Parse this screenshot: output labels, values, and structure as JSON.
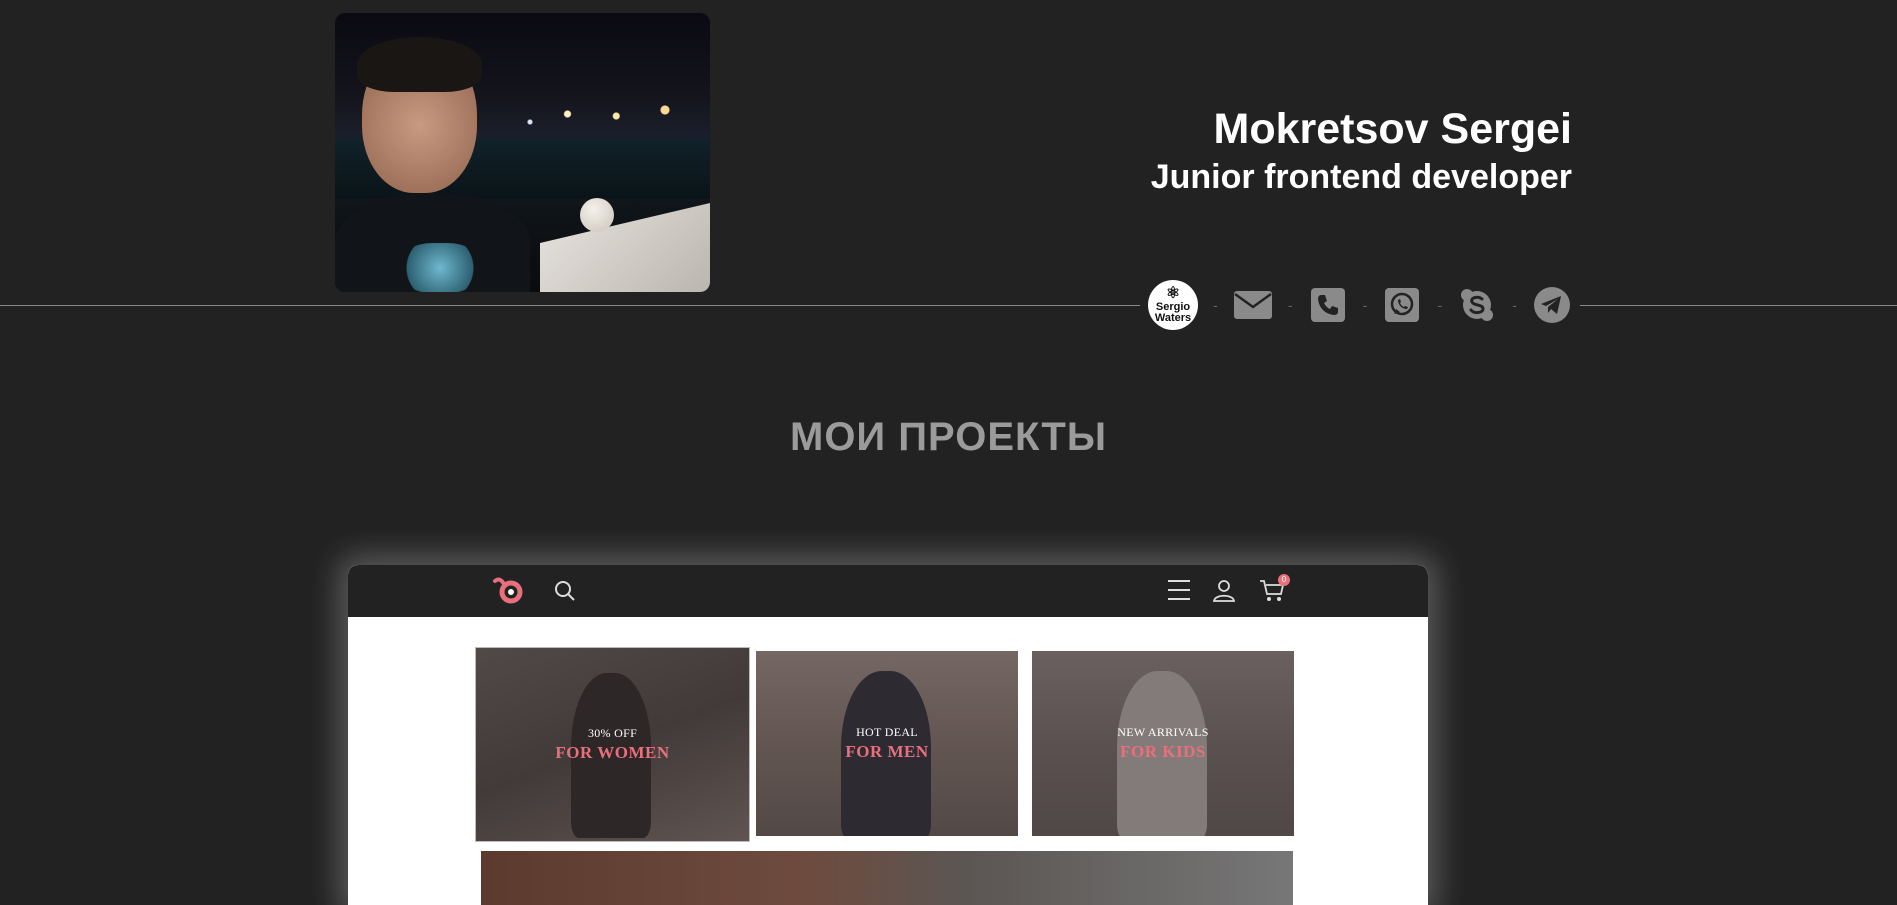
{
  "profile": {
    "name": "Mokretsov Sergei",
    "role": "Junior frontend developer",
    "photo_alt": "avatar"
  },
  "contacts": {
    "logo_line1": "Sergio",
    "logo_line2": "Waters",
    "items": [
      {
        "icon": "envelope-icon"
      },
      {
        "icon": "phone-icon"
      },
      {
        "icon": "whatsapp-icon"
      },
      {
        "icon": "skype-icon"
      },
      {
        "icon": "telegram-icon"
      }
    ],
    "separator": "-"
  },
  "projects": {
    "title": "МОИ ПРОЕКТЫ",
    "preview": {
      "cart_count": "0",
      "cards": [
        {
          "small": "30% OFF",
          "big": "FOR WOMEN"
        },
        {
          "small": "HOT DEAL",
          "big": "FOR MEN"
        },
        {
          "small": "NEW ARRIVALS",
          "big": "FOR KIDS"
        }
      ]
    }
  },
  "colors": {
    "background": "#222222",
    "accent_pink": "#e8707d",
    "title_gray": "#9b9b9b"
  }
}
